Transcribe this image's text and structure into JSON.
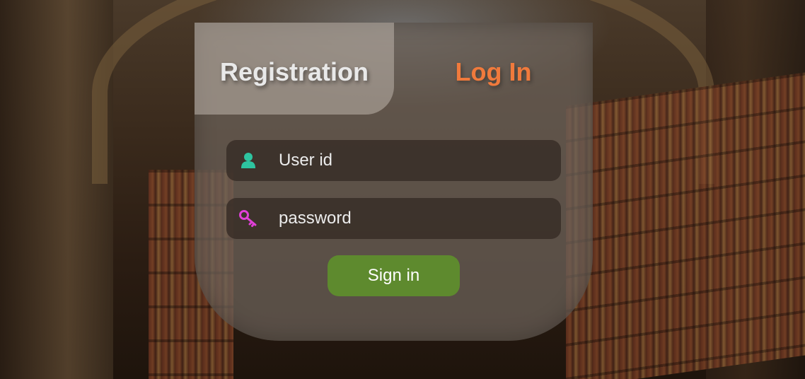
{
  "tabs": {
    "registration_label": "Registration",
    "login_label": "Log In"
  },
  "form": {
    "user_id": {
      "placeholder": "User id",
      "value": "",
      "icon": "user-icon"
    },
    "password": {
      "placeholder": "password",
      "value": "",
      "icon": "key-icon"
    },
    "submit_label": "Sign in"
  },
  "colors": {
    "login_tab": "#f07a3c",
    "user_icon": "#2ec4a0",
    "key_icon": "#e040d8",
    "signin_button": "#5e8a2e"
  }
}
